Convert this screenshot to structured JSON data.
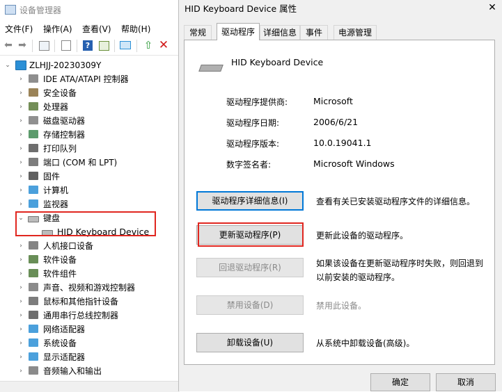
{
  "device_manager": {
    "title": "设备管理器",
    "menu": [
      "文件(F)",
      "操作(A)",
      "查看(V)",
      "帮助(H)"
    ],
    "root_label": "ZLHJJ-20230309Y",
    "tree": [
      {
        "label": "IDE ATA/ATAPI 控制器",
        "icon": "ide-controller-icon",
        "color": "#7a7a7a"
      },
      {
        "label": "安全设备",
        "icon": "security-device-icon",
        "color": "#8a6d3b"
      },
      {
        "label": "处理器",
        "icon": "processor-icon",
        "color": "#5b7a3a"
      },
      {
        "label": "磁盘驱动器",
        "icon": "disk-drive-icon",
        "color": "#7d7d7d"
      },
      {
        "label": "存储控制器",
        "icon": "storage-controller-icon",
        "color": "#3f8a52"
      },
      {
        "label": "打印队列",
        "icon": "printer-icon",
        "color": "#555555"
      },
      {
        "label": "端口 (COM 和 LPT)",
        "icon": "port-icon",
        "color": "#666666"
      },
      {
        "label": "固件",
        "icon": "firmware-icon",
        "color": "#444444"
      },
      {
        "label": "计算机",
        "icon": "computer-icon",
        "color": "#2b8fd6"
      },
      {
        "label": "监视器",
        "icon": "monitor-icon",
        "color": "#2b8fd6"
      }
    ],
    "keyboard_group": {
      "label": "键盘",
      "child": "HID Keyboard Device"
    },
    "tree_after": [
      {
        "label": "人机接口设备",
        "icon": "hid-icon",
        "color": "#6f6f6f"
      },
      {
        "label": "软件设备",
        "icon": "software-device-icon",
        "color": "#4f7a3a"
      },
      {
        "label": "软件组件",
        "icon": "software-component-icon",
        "color": "#4f7a3a"
      },
      {
        "label": "声音、视频和游戏控制器",
        "icon": "audio-icon",
        "color": "#777777"
      },
      {
        "label": "鼠标和其他指针设备",
        "icon": "mouse-icon",
        "color": "#666666"
      },
      {
        "label": "通用串行总线控制器",
        "icon": "usb-icon",
        "color": "#555555"
      },
      {
        "label": "网络适配器",
        "icon": "network-adapter-icon",
        "color": "#2b8fd6"
      },
      {
        "label": "系统设备",
        "icon": "system-device-icon",
        "color": "#2b8fd6"
      },
      {
        "label": "显示适配器",
        "icon": "display-adapter-icon",
        "color": "#2b8fd6"
      },
      {
        "label": "音频输入和输出",
        "icon": "audio-io-icon",
        "color": "#777777"
      }
    ]
  },
  "dialog": {
    "title": "HID Keyboard Device 属性",
    "close_glyph": "✕",
    "tabs": [
      "常规",
      "驱动程序",
      "详细信息",
      "事件",
      "电源管理"
    ],
    "active_tab": "驱动程序",
    "device_name": "HID Keyboard Device",
    "props": [
      {
        "label": "驱动程序提供商:",
        "value": "Microsoft"
      },
      {
        "label": "驱动程序日期:",
        "value": "2006/6/21"
      },
      {
        "label": "驱动程序版本:",
        "value": "10.0.19041.1"
      },
      {
        "label": "数字签名者:",
        "value": "Microsoft Windows"
      }
    ],
    "actions": [
      {
        "button": "驱动程序详细信息(I)",
        "desc": "查看有关已安装驱动程序文件的详细信息。"
      },
      {
        "button": "更新驱动程序(P)",
        "desc": "更新此设备的驱动程序。"
      },
      {
        "button": "回退驱动程序(R)",
        "desc": "如果该设备在更新驱动程序时失败，则回退到以前安装的驱动程序。"
      },
      {
        "button": "禁用设备(D)",
        "desc": "禁用此设备。"
      },
      {
        "button": "卸载设备(U)",
        "desc": "从系统中卸载设备(高级)。"
      }
    ],
    "ok": "确定",
    "cancel": "取消"
  },
  "colors": {
    "highlight": "#e0261f",
    "focus": "#0078d7"
  }
}
